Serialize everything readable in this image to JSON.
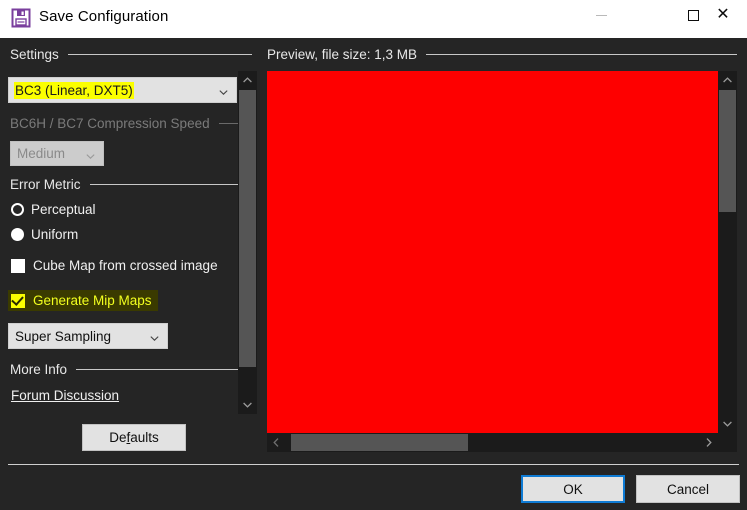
{
  "window": {
    "title": "Save Configuration",
    "icon": "save-floppy-icon",
    "controls": {
      "minimize": "minimize-icon",
      "maximize": "maximize-icon",
      "close": "close-icon"
    }
  },
  "settings": {
    "header": "Settings",
    "format_combo": {
      "value": "BC3 (Linear, DXT5)",
      "highlighted": true,
      "highlight_color": "#fbff00"
    },
    "compression_speed": {
      "header": "BC6H / BC7 Compression Speed",
      "enabled": false,
      "value": "Medium"
    },
    "error_metric": {
      "header": "Error Metric",
      "options": [
        {
          "label": "Perceptual",
          "selected": false
        },
        {
          "label": "Uniform",
          "selected": true
        }
      ]
    },
    "cube_map": {
      "label": "Cube Map from crossed image",
      "checked": false
    },
    "mip_maps": {
      "label": "Generate Mip Maps",
      "checked": true,
      "highlighted": true,
      "highlight_bg": "#3a3a00",
      "highlight_fg": "#f2ff1e"
    },
    "mip_filter": {
      "value": "Super Sampling"
    },
    "more_info": {
      "header": "More Info",
      "link": "Forum Discussion"
    },
    "defaults_button": {
      "label_pre": "De",
      "label_mnemonic": "f",
      "label_post": "aults"
    }
  },
  "preview": {
    "header": "Preview, file size: 1,3 MB",
    "file_size": "1,3 MB",
    "image_color": "#fe0000"
  },
  "scrollbars": {
    "up_arrow": "chevron-up-icon",
    "down_arrow": "chevron-down-icon",
    "left_arrow": "chevron-left-icon",
    "right_arrow": "chevron-right-icon"
  },
  "footer": {
    "ok_label": "OK",
    "cancel_label": "Cancel",
    "focus_color": "#0f7bd4"
  }
}
